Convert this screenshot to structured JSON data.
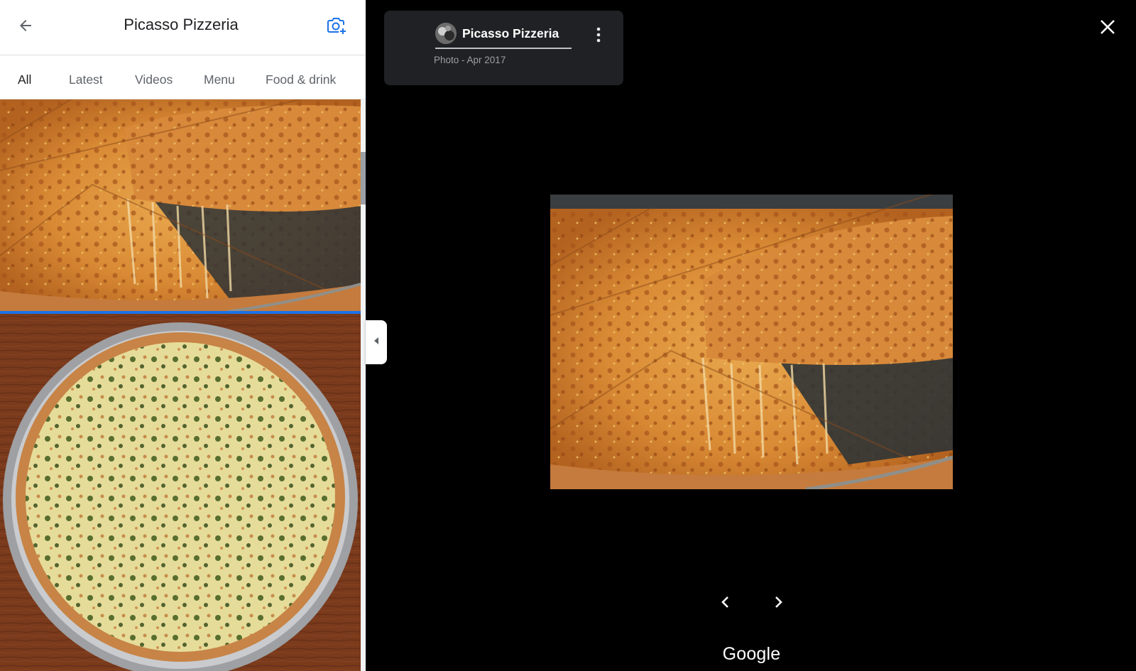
{
  "panel": {
    "title": "Picasso Pizzeria",
    "tabs": [
      {
        "label": "All",
        "selected": true
      },
      {
        "label": "Latest",
        "selected": false
      },
      {
        "label": "Videos",
        "selected": false
      },
      {
        "label": "Menu",
        "selected": false
      },
      {
        "label": "Food & drink",
        "selected": false
      }
    ],
    "photos": [
      {
        "subject": "cheese pizza slice with stretched cheese",
        "selected": true
      },
      {
        "subject": "spinach artichoke pizza on tray"
      }
    ]
  },
  "viewer": {
    "card": {
      "title": "Picasso Pizzeria",
      "subtitle": "Photo - Apr 2017"
    },
    "main_photo": {
      "subject": "cheese pizza slice with stretched cheese"
    }
  },
  "footer": {
    "logo": "Google"
  },
  "icons": {
    "back": "arrow-left-icon",
    "add_photo": "camera-plus-icon",
    "collapse": "caret-left-icon",
    "more": "more-vert-icon",
    "close": "close-icon",
    "prev": "chevron-left-icon",
    "next": "chevron-right-icon"
  },
  "colors": {
    "accent": "#1a73e8",
    "viewer_bg": "#000000",
    "card_bg": "#202124"
  }
}
